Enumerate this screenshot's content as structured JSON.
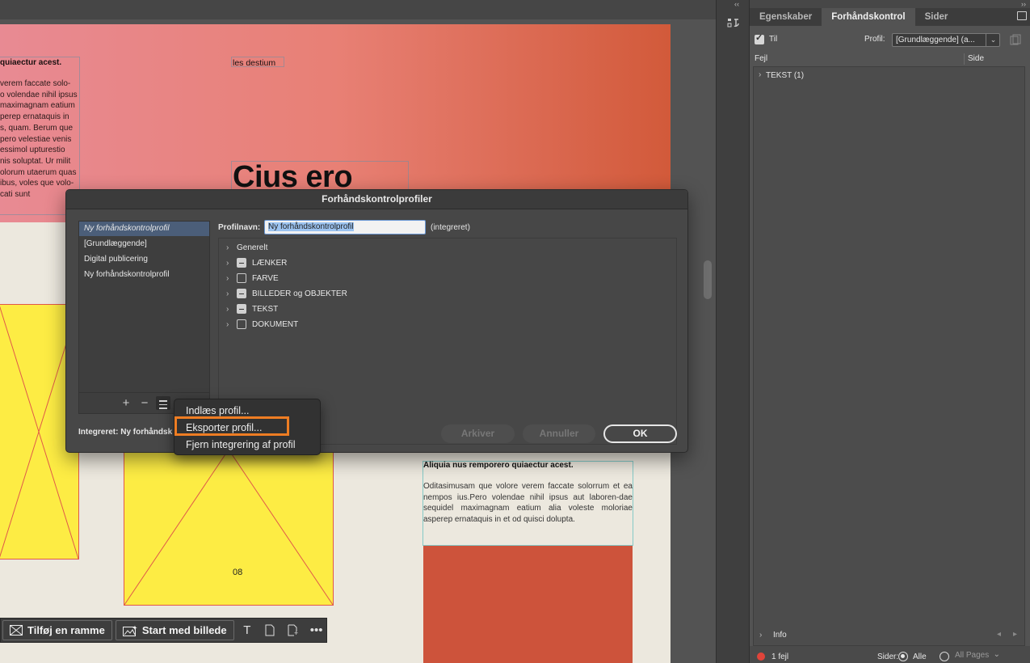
{
  "document": {
    "hero_column_heading": "quiaectur acest.",
    "hero_column_body": "verem faccate solo-\no volendae nihil ipsus\nmaximagnam eatium\nperep ernataquis in\ns, quam. Berum que\npero velestiae venis\n essimol upturestio\nnis soluptat. Ur milit\nolorum utaerum quas\nibus, voles que volo-\ncati sunt",
    "hero_tag": "les destium",
    "hero_title": "Cius ero",
    "article_heading": "Aliquia nus remporero quiaectur acest.",
    "article_body": "Oditasimusam que volore verem faccate solorrum et ea nempos ius.Pero volendae nihil ipsus aut laboren-dae sequidel maximagnam eatium alia voleste moloriae asperep ernataquis in et od quisci dolupta.",
    "page_number": "08"
  },
  "context_bar": {
    "add_frame_label": "Tilføj en ramme",
    "start_with_image_label": "Start med billede"
  },
  "panel": {
    "tabs": [
      "Egenskaber",
      "Forhåndskontrol",
      "Sider"
    ],
    "on_label": "Til",
    "profile_label": "Profil:",
    "profile_value": "[Grundlæggende] (a...",
    "col_error": "Fejl",
    "col_page": "Side",
    "tree_text": "TEKST (1)",
    "info_label": "Info",
    "error_count": "1 fejl",
    "pages_label": "Sider:",
    "all_label": "Alle",
    "pages_placeholder": "All Pages"
  },
  "dialog": {
    "title": "Forhåndskontrolprofiler",
    "profiles": [
      "Ny forhåndskontrolprofil",
      "[Grundlæggende]",
      "Digital publicering",
      "Ny forhåndskontrolprofil"
    ],
    "add": "+",
    "remove": "−",
    "profile_name_label": "Profilnavn:",
    "profile_name_value": "Ny forhåndskontrolprofil",
    "embedded_tag": "(integreret)",
    "categories": [
      {
        "label": "Generelt",
        "checkbox": "none"
      },
      {
        "label": "LÆNKER",
        "checkbox": "mixed"
      },
      {
        "label": "FARVE",
        "checkbox": "empty"
      },
      {
        "label": "BILLEDER og OBJEKTER",
        "checkbox": "mixed"
      },
      {
        "label": "TEKST",
        "checkbox": "mixed"
      },
      {
        "label": "DOKUMENT",
        "checkbox": "empty"
      }
    ],
    "embedded_status": "Integreret: Ny forhåndsk",
    "save_button": "Arkiver",
    "cancel_button": "Annuller",
    "ok_button": "OK"
  },
  "popup_menu": {
    "items": [
      "Indlæs profil...",
      "Eksporter profil...",
      "Fjern integrering af profil"
    ],
    "highlighted_index": 1,
    "highlight_color": "#ee7d23"
  },
  "colors": {
    "hero_start": "#e88a93",
    "hero_end": "#d25a3a",
    "frame_yellow": "#fdec44",
    "red_block": "#cd533b",
    "selection_blue": "#4b5e79",
    "error_dot": "#e0443a"
  }
}
